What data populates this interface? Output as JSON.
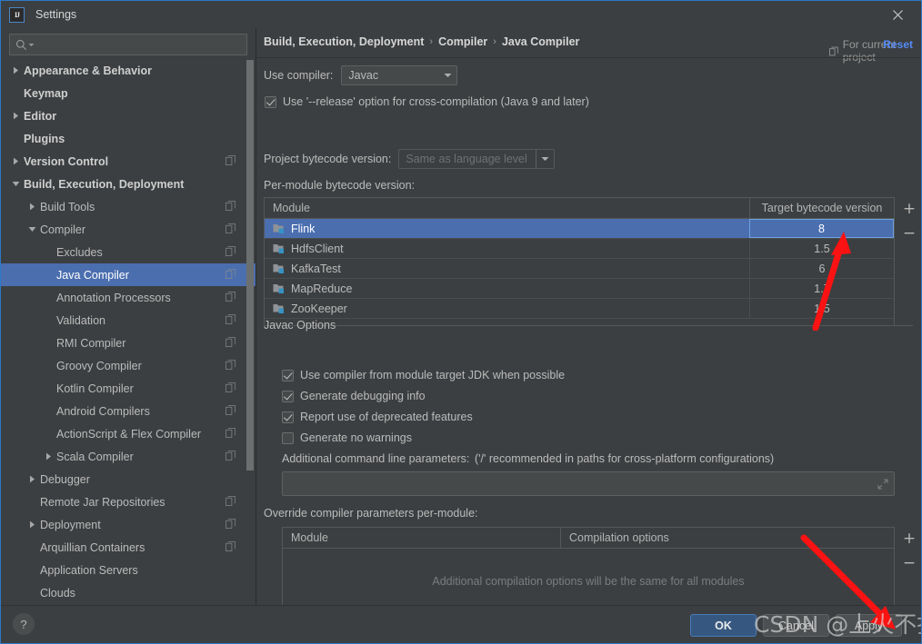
{
  "window": {
    "title": "Settings",
    "logo_text": "IJ",
    "close_icon": "close-icon"
  },
  "sidebar": {
    "search": {
      "value": "",
      "placeholder": ""
    },
    "items": [
      {
        "label": "Appearance & Behavior",
        "indent": 0,
        "arrow": "right",
        "bold": true,
        "copy": false,
        "selected": false
      },
      {
        "label": "Keymap",
        "indent": 0,
        "arrow": "none",
        "bold": true,
        "copy": false,
        "selected": false
      },
      {
        "label": "Editor",
        "indent": 0,
        "arrow": "right",
        "bold": true,
        "copy": false,
        "selected": false
      },
      {
        "label": "Plugins",
        "indent": 0,
        "arrow": "none",
        "bold": true,
        "copy": false,
        "selected": false
      },
      {
        "label": "Version Control",
        "indent": 0,
        "arrow": "right",
        "bold": true,
        "copy": true,
        "selected": false
      },
      {
        "label": "Build, Execution, Deployment",
        "indent": 0,
        "arrow": "down",
        "bold": true,
        "copy": false,
        "selected": false
      },
      {
        "label": "Build Tools",
        "indent": 1,
        "arrow": "right",
        "bold": false,
        "copy": true,
        "selected": false
      },
      {
        "label": "Compiler",
        "indent": 1,
        "arrow": "down",
        "bold": false,
        "copy": true,
        "selected": false
      },
      {
        "label": "Excludes",
        "indent": 2,
        "arrow": "none",
        "bold": false,
        "copy": true,
        "selected": false
      },
      {
        "label": "Java Compiler",
        "indent": 2,
        "arrow": "none",
        "bold": false,
        "copy": true,
        "selected": true
      },
      {
        "label": "Annotation Processors",
        "indent": 2,
        "arrow": "none",
        "bold": false,
        "copy": true,
        "selected": false
      },
      {
        "label": "Validation",
        "indent": 2,
        "arrow": "none",
        "bold": false,
        "copy": true,
        "selected": false
      },
      {
        "label": "RMI Compiler",
        "indent": 2,
        "arrow": "none",
        "bold": false,
        "copy": true,
        "selected": false
      },
      {
        "label": "Groovy Compiler",
        "indent": 2,
        "arrow": "none",
        "bold": false,
        "copy": true,
        "selected": false
      },
      {
        "label": "Kotlin Compiler",
        "indent": 2,
        "arrow": "none",
        "bold": false,
        "copy": true,
        "selected": false
      },
      {
        "label": "Android Compilers",
        "indent": 2,
        "arrow": "none",
        "bold": false,
        "copy": true,
        "selected": false
      },
      {
        "label": "ActionScript & Flex Compiler",
        "indent": 2,
        "arrow": "none",
        "bold": false,
        "copy": true,
        "selected": false
      },
      {
        "label": "Scala Compiler",
        "indent": 2,
        "arrow": "right",
        "bold": false,
        "copy": true,
        "selected": false
      },
      {
        "label": "Debugger",
        "indent": 1,
        "arrow": "right",
        "bold": false,
        "copy": false,
        "selected": false
      },
      {
        "label": "Remote Jar Repositories",
        "indent": 1,
        "arrow": "none",
        "bold": false,
        "copy": true,
        "selected": false
      },
      {
        "label": "Deployment",
        "indent": 1,
        "arrow": "right",
        "bold": false,
        "copy": true,
        "selected": false
      },
      {
        "label": "Arquillian Containers",
        "indent": 1,
        "arrow": "none",
        "bold": false,
        "copy": true,
        "selected": false
      },
      {
        "label": "Application Servers",
        "indent": 1,
        "arrow": "none",
        "bold": false,
        "copy": false,
        "selected": false
      },
      {
        "label": "Clouds",
        "indent": 1,
        "arrow": "none",
        "bold": false,
        "copy": false,
        "selected": false
      }
    ]
  },
  "main": {
    "breadcrumb": [
      "Build, Execution, Deployment",
      "Compiler",
      "Java Compiler"
    ],
    "breadcrumb_sep": "›",
    "for_current_project": "For current project",
    "reset_label": "Reset",
    "use_compiler_label": "Use compiler:",
    "use_compiler_value": "Javac",
    "release_option_label": "Use '--release' option for cross-compilation (Java 9 and later)",
    "release_option_checked": true,
    "project_bytecode_label": "Project bytecode version:",
    "project_bytecode_value": "Same as language level",
    "per_module_label": "Per-module bytecode version:",
    "bytecode_table": {
      "columns": [
        "Module",
        "Target bytecode version"
      ],
      "rows": [
        {
          "module": "Flink",
          "version": "8",
          "selected": true,
          "editing": true
        },
        {
          "module": "HdfsClient",
          "version": "1.5",
          "selected": false,
          "editing": false
        },
        {
          "module": "KafkaTest",
          "version": "6",
          "selected": false,
          "editing": false
        },
        {
          "module": "MapReduce",
          "version": "1.7",
          "selected": false,
          "editing": false
        },
        {
          "module": "ZooKeeper",
          "version": "1.5",
          "selected": false,
          "editing": false
        }
      ],
      "add_label": "+",
      "remove_label": "−"
    },
    "javac_options": {
      "group_label": "Javac Options",
      "checkboxes": [
        {
          "label": "Use compiler from module target JDK when possible",
          "checked": true
        },
        {
          "label": "Generate debugging info",
          "checked": true
        },
        {
          "label": "Report use of deprecated features",
          "checked": true
        },
        {
          "label": "Generate no warnings",
          "checked": false
        }
      ],
      "additional_params_label": "Additional command line parameters:",
      "additional_params_hint": "('/' recommended in paths for cross-platform configurations)",
      "additional_params_value": ""
    },
    "override_section": {
      "label": "Override compiler parameters per-module:",
      "columns": [
        "Module",
        "Compilation options"
      ],
      "empty_message": "Additional compilation options will be the same for all modules",
      "add_label": "+",
      "remove_label": "−"
    }
  },
  "footer": {
    "help_label": "?",
    "ok_label": "OK",
    "cancel_label": "Cancel",
    "apply_label": "Apply"
  },
  "annotations": {
    "watermark": "CSDN @上火不找我",
    "arrow_color": "#fb1212",
    "arrows": [
      {
        "name": "arrow-to-bytecode-version"
      },
      {
        "name": "arrow-to-apply-button"
      }
    ]
  },
  "colors": {
    "background": "#3c3f41",
    "selection": "#4b6eaf",
    "accent_link": "#548af7",
    "primary_button": "#365880"
  }
}
